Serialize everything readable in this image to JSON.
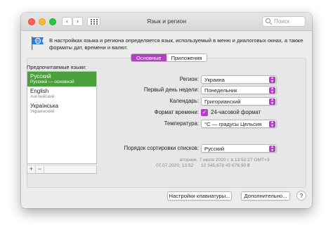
{
  "window": {
    "title": "Язык и регион",
    "search_placeholder": "Поиск",
    "description": "В настройках языка и региона определяется язык, используемый в меню и диалоговых окнах, а также форматы дат, времени и валют."
  },
  "tabs": [
    {
      "label": "Основные",
      "active": true
    },
    {
      "label": "Приложения",
      "active": false
    }
  ],
  "languages": {
    "label": "Предпочитаемые языки:",
    "items": [
      {
        "name": "Русский",
        "sub": "Русский — основной",
        "selected": true
      },
      {
        "name": "English",
        "sub": "Английский",
        "selected": false
      },
      {
        "name": "Українська",
        "sub": "Украинский",
        "selected": false
      }
    ],
    "add_label": "+",
    "remove_label": "−"
  },
  "settings": {
    "region": {
      "label": "Регион:",
      "value": "Украина"
    },
    "first_day": {
      "label": "Первый день недели:",
      "value": "Понедельник"
    },
    "calendar": {
      "label": "Календарь:",
      "value": "Григорианский"
    },
    "time_format": {
      "label": "Формат времени:",
      "checkbox_label": "24-часовой формат",
      "checked": true
    },
    "temperature": {
      "label": "Температура:",
      "value": "°C — градусы Цельсия"
    },
    "sort_order": {
      "label": "Порядок сортировки списков:",
      "value": "Русский"
    }
  },
  "sample": {
    "line1": "вторник, 7 июля 2020 г. в 13:52:27 GMT+3",
    "line2_left": "07.07.2020, 13:52",
    "line2_right": "12 345,678    45 678,90 ₴"
  },
  "buttons": {
    "keyboard": "Настройки клавиатуры...",
    "advanced": "Дополнительно...",
    "help": "?"
  },
  "colors": {
    "accent": "#b43ec6",
    "selection": "#4aa03a"
  }
}
